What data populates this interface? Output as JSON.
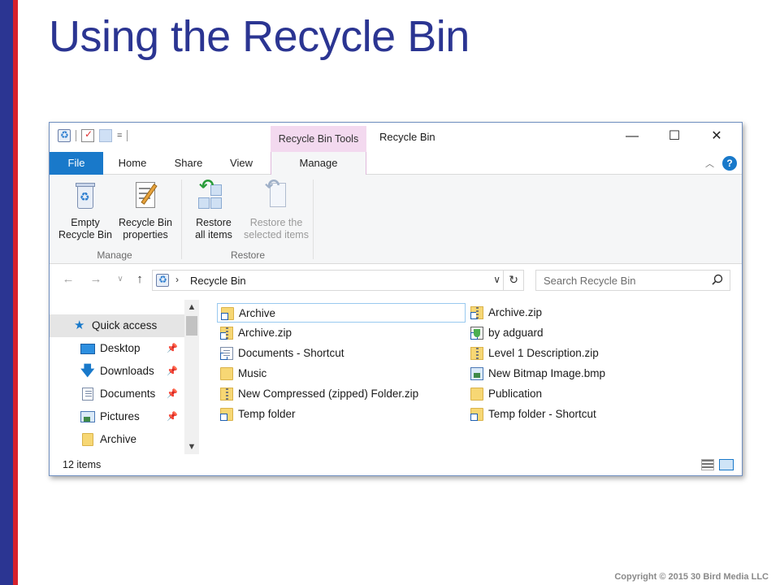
{
  "slide": {
    "title": "Using the Recycle Bin",
    "copyright": "Copyright © 2015 30 Bird Media LLC"
  },
  "window": {
    "title": "Recycle Bin",
    "contextual_tab": "Recycle Bin Tools",
    "qat_dropdown": "=",
    "controls": {
      "minimize": "—",
      "maximize": "☐",
      "close": "✕"
    }
  },
  "tabs": [
    {
      "label": "File"
    },
    {
      "label": "Home"
    },
    {
      "label": "Share"
    },
    {
      "label": "View"
    },
    {
      "label": "Manage"
    }
  ],
  "ribbon": {
    "groups": [
      {
        "label": "Manage",
        "buttons": [
          {
            "label_line1": "Empty",
            "label_line2": "Recycle Bin",
            "icon": "recycle-bin-icon",
            "enabled": true
          },
          {
            "label_line1": "Recycle Bin",
            "label_line2": "properties",
            "icon": "properties-icon",
            "enabled": true
          }
        ]
      },
      {
        "label": "Restore",
        "buttons": [
          {
            "label_line1": "Restore",
            "label_line2": "all items",
            "icon": "restore-all-icon",
            "enabled": true
          },
          {
            "label_line1": "Restore the",
            "label_line2": "selected items",
            "icon": "restore-selected-icon",
            "enabled": false
          }
        ]
      }
    ]
  },
  "address": {
    "path_label": "Recycle Bin",
    "search_placeholder": "Search Recycle Bin"
  },
  "nav_pane": {
    "items": [
      {
        "label": "Quick access",
        "icon": "star-icon",
        "pinned": false,
        "selected": true
      },
      {
        "label": "Desktop",
        "icon": "desktop-icon",
        "pinned": true
      },
      {
        "label": "Downloads",
        "icon": "download-icon",
        "pinned": true
      },
      {
        "label": "Documents",
        "icon": "documents-icon",
        "pinned": true
      },
      {
        "label": "Pictures",
        "icon": "pictures-icon",
        "pinned": true
      },
      {
        "label": "Archive",
        "icon": "folder-icon",
        "pinned": false
      }
    ]
  },
  "files": {
    "left_column": [
      {
        "name": "Archive",
        "type": "folder-shortcut"
      },
      {
        "name": "Archive.zip",
        "type": "zip-shortcut"
      },
      {
        "name": "Documents - Shortcut",
        "type": "doc-shortcut"
      },
      {
        "name": "Music",
        "type": "folder"
      },
      {
        "name": "New Compressed (zipped) Folder.zip",
        "type": "zip"
      },
      {
        "name": "Temp folder",
        "type": "folder-shortcut"
      }
    ],
    "right_column": [
      {
        "name": "Archive.zip",
        "type": "zip-shortcut"
      },
      {
        "name": "by adguard",
        "type": "adguard-shortcut"
      },
      {
        "name": "Level 1 Description.zip",
        "type": "zip"
      },
      {
        "name": "New Bitmap Image.bmp",
        "type": "bitmap"
      },
      {
        "name": "Publication",
        "type": "folder"
      },
      {
        "name": "Temp folder - Shortcut",
        "type": "folder-shortcut"
      }
    ]
  },
  "status": {
    "item_count": "12 items"
  }
}
